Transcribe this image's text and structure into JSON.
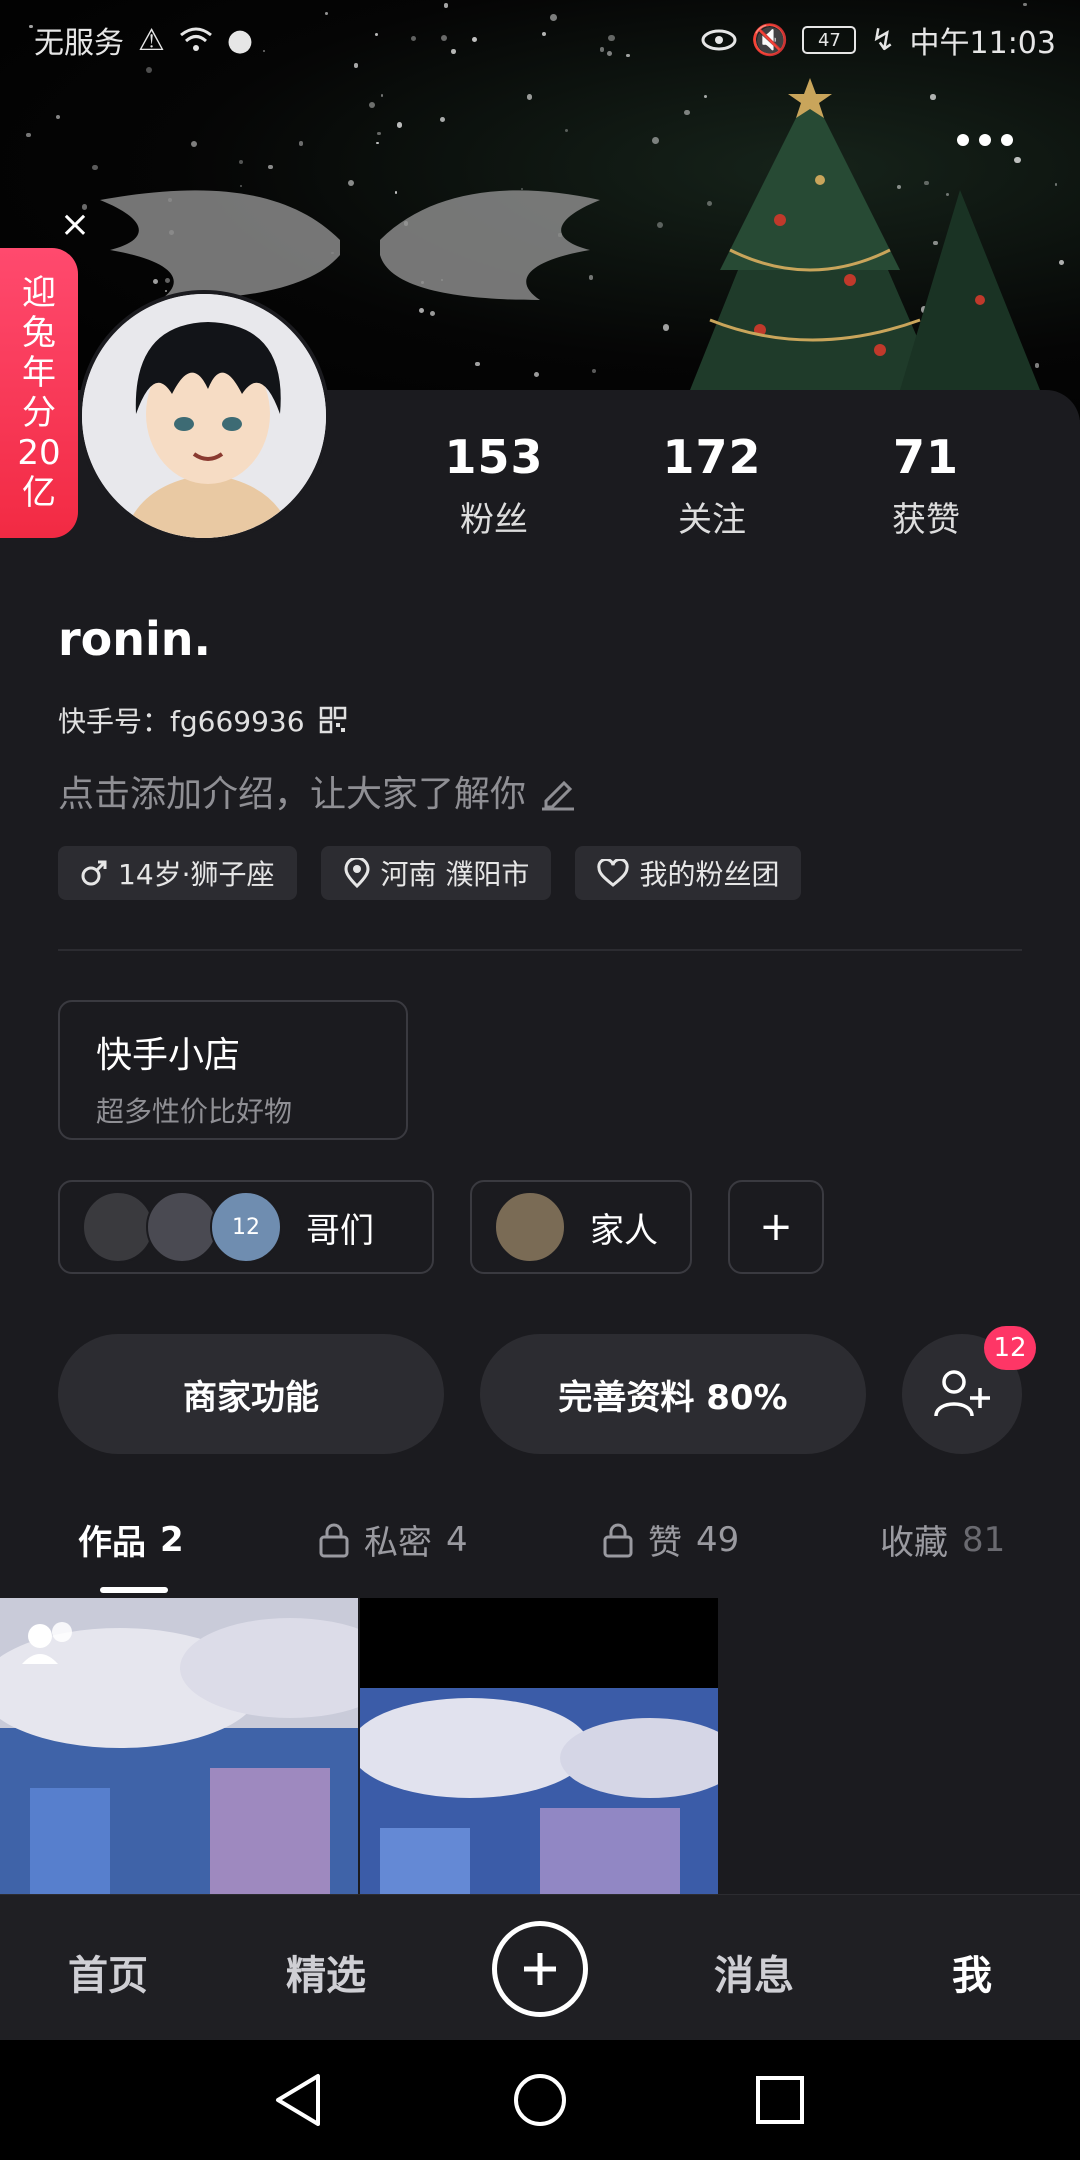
{
  "status_bar": {
    "carrier": "无服务",
    "time": "中午11:03",
    "battery": "47"
  },
  "promo": {
    "text": "迎兔年分20亿"
  },
  "profile": {
    "name": "ronin.",
    "kuaishou_id": "快手号：fg669936",
    "bio_placeholder": "点击添加介绍，让大家了解你",
    "stats": [
      {
        "value": "153",
        "label": "粉丝"
      },
      {
        "value": "172",
        "label": "关注"
      },
      {
        "value": "71",
        "label": "获赞"
      }
    ],
    "tags": [
      {
        "icon": "male-icon",
        "text": "14岁·狮子座"
      },
      {
        "icon": "location-pin-icon",
        "text": "河南 濮阳市"
      },
      {
        "icon": "heart-icon",
        "text": "我的粉丝团"
      }
    ]
  },
  "shop": {
    "title": "快手小店",
    "subtitle": "超多性价比好物"
  },
  "groups": [
    {
      "label": "哥们",
      "extra_count": "12"
    },
    {
      "label": "家人"
    }
  ],
  "actions": {
    "merchant": "商家功能",
    "complete_profile": "完善资料 80%",
    "friend_badge": "12"
  },
  "tabs": [
    {
      "label": "作品",
      "count": "2",
      "locked": false
    },
    {
      "label": "私密",
      "count": "4",
      "locked": true
    },
    {
      "label": "赞",
      "count": "49",
      "locked": true
    },
    {
      "label": "收藏",
      "count": "81",
      "locked": false
    }
  ],
  "bottom_nav": {
    "home": "首页",
    "featured": "精选",
    "messages": "消息",
    "me": "我"
  },
  "colors": {
    "background": "#1b1b1f",
    "card": "#2c2c31",
    "badge": "#fe3666",
    "promo": "#f22a43"
  }
}
